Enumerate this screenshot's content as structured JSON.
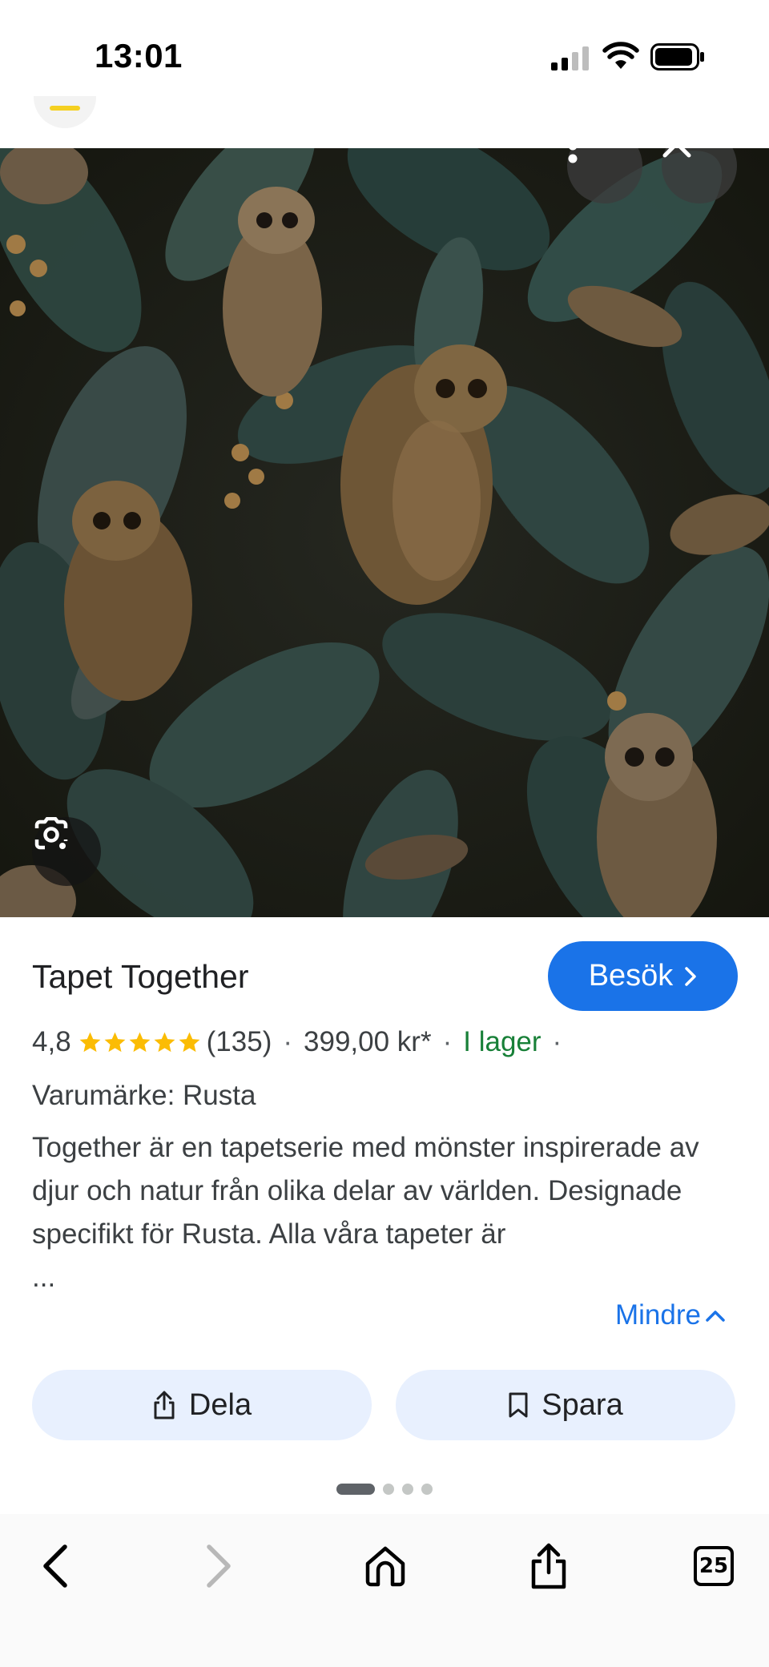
{
  "status_bar": {
    "time": "13:01"
  },
  "product": {
    "title": "Tapet Together",
    "visit_label": "Besök",
    "rating": "4,8",
    "stars": 5,
    "reviews": "(135)",
    "price": "399,00 kr*",
    "availability": "I lager",
    "brand": "Varumärke: Rusta",
    "description": "Together är en tapetserie med mönster inspirerade av djur och natur från olika delar av världen. Designade specifikt för Rusta. Alla våra tapeter är",
    "ellipsis": "...",
    "less_label": "Mindre"
  },
  "actions": {
    "share_label": "Dela",
    "save_label": "Spara"
  },
  "pager": {
    "current": 1,
    "total": 4
  },
  "toolbar": {
    "tab_count": "25"
  },
  "colors": {
    "accent": "#1a73e8",
    "in_stock": "#188038",
    "star": "#fbbc04",
    "chip_bg": "#e8f0fe"
  },
  "icons": [
    "more-vert-icon",
    "close-icon",
    "lens-icon",
    "chevron-right-icon",
    "star-icon",
    "chevron-up-icon",
    "share-icon",
    "bookmark-icon",
    "back-icon",
    "forward-icon",
    "home-icon",
    "browser-share-icon",
    "tabs-icon"
  ]
}
